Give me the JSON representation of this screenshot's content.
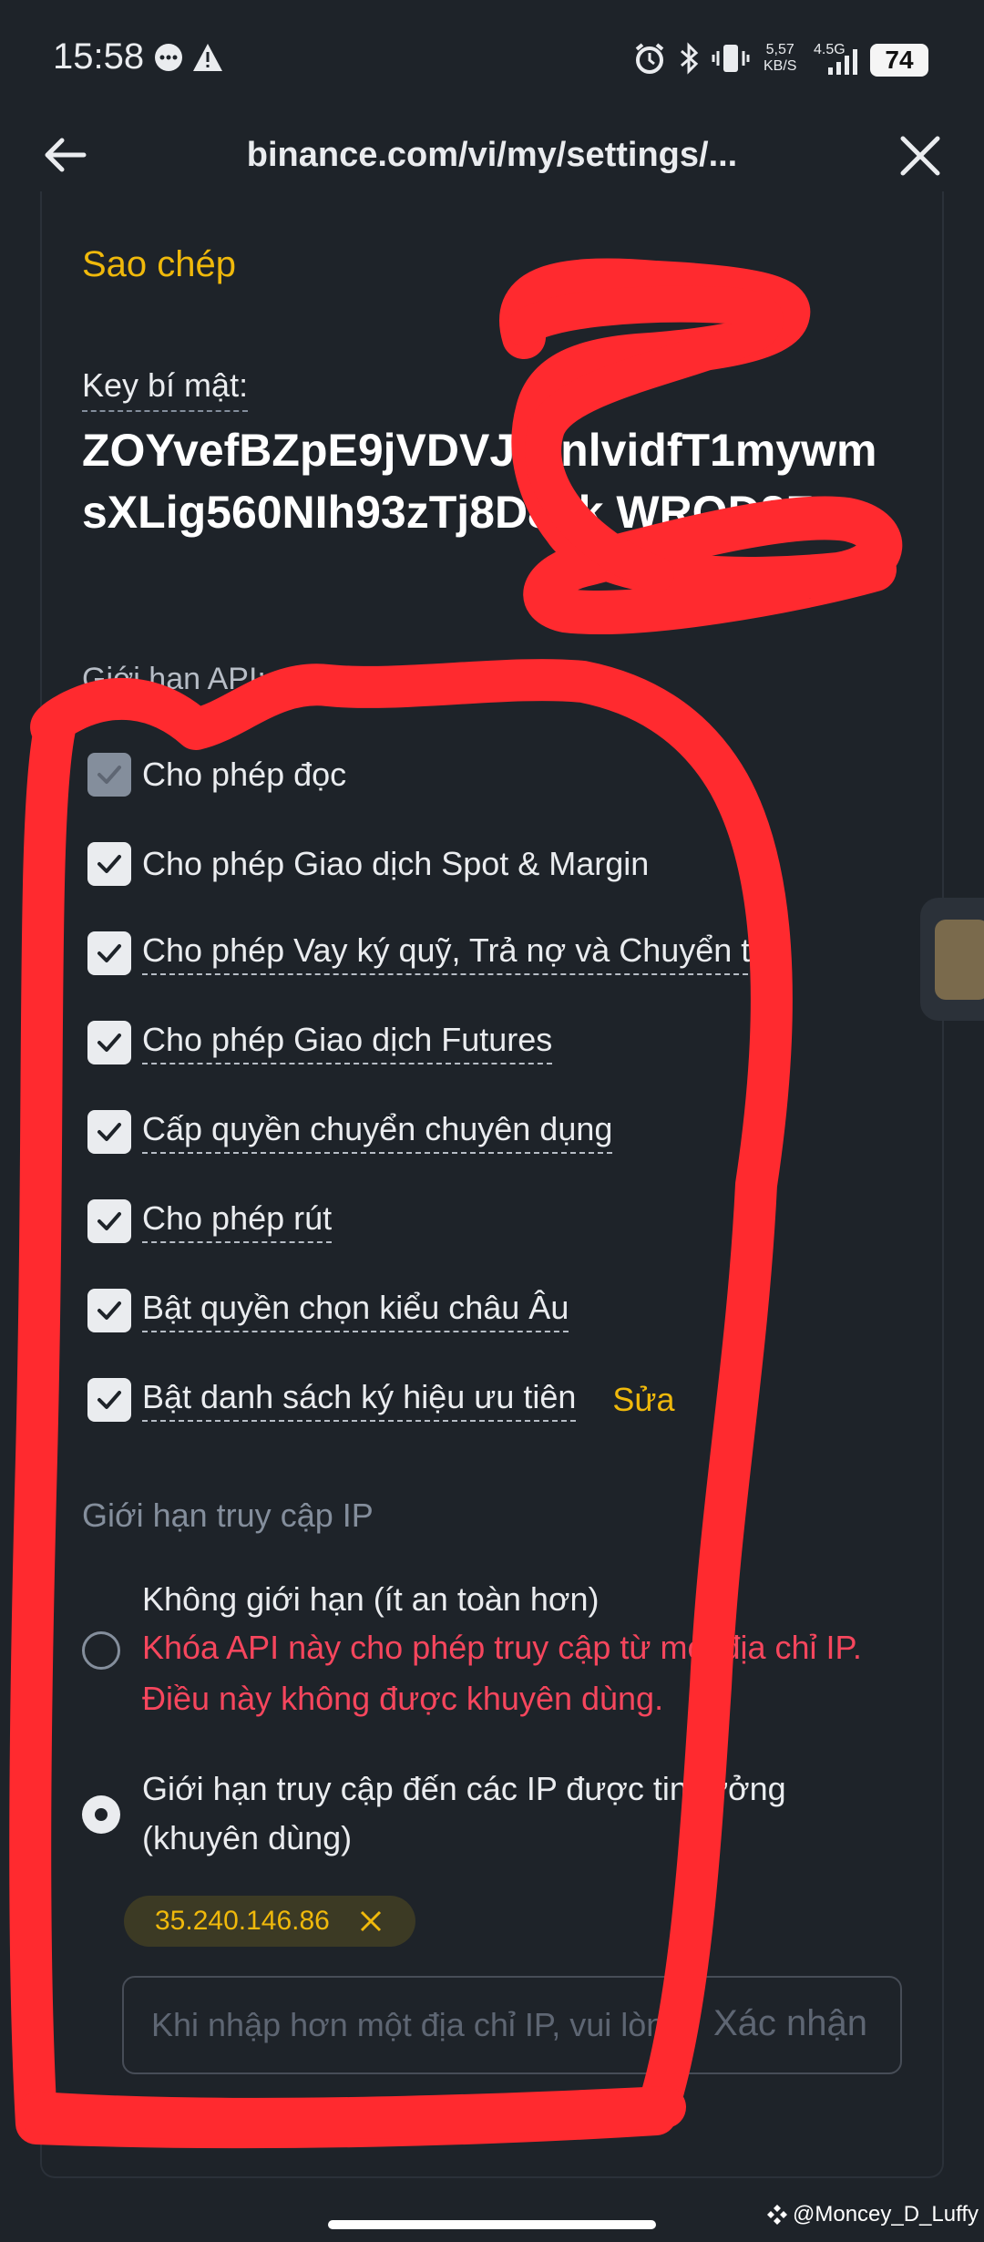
{
  "status_bar": {
    "time": "15:58",
    "net_speed": "5,57",
    "net_unit": "KB/S",
    "network": "4.5G",
    "battery": "74"
  },
  "nav": {
    "url": "binance.com/vi/my/settings/..."
  },
  "copy_label": "Sao chép",
  "secret_key": {
    "label": "Key bí mật:",
    "value": "ZOYvefBZpE9jVDVJtYnlvidfT1mywmsXLig560NIh93zTj8D8Jk WROD8Z"
  },
  "api_restrictions": {
    "label": "Giới hạn API:",
    "permissions": [
      {
        "label": "Cho phép đọc",
        "dashed": false,
        "disabled": true
      },
      {
        "label": "Cho phép Giao dịch Spot & Margin",
        "dashed": false,
        "disabled": false
      },
      {
        "label": "Cho phép Vay ký quỹ, Trả nợ và Chuyển tiề",
        "dashed": true,
        "disabled": false
      },
      {
        "label": "Cho phép Giao dịch Futures",
        "dashed": true,
        "disabled": false
      },
      {
        "label": "Cấp quyền chuyển chuyên dụng",
        "dashed": true,
        "disabled": false
      },
      {
        "label": "Cho phép rút",
        "dashed": true,
        "disabled": false
      },
      {
        "label": "Bật quyền chọn kiểu châu Âu",
        "dashed": true,
        "disabled": false
      },
      {
        "label": "Bật danh sách ký hiệu ưu tiên",
        "dashed": true,
        "disabled": false
      }
    ],
    "edit_label": "Sửa"
  },
  "ip_access": {
    "title": "Giới hạn truy cập IP",
    "unrestricted": {
      "label": "Không giới hạn (ít an toàn hơn)",
      "warning": "Khóa API này cho phép truy cập từ mọi địa chỉ IP. Điều này không được khuyên dùng."
    },
    "restricted": {
      "label": "Giới hạn truy cập đến các IP được tin tưởng (khuyên dùng)"
    },
    "selected": "restricted",
    "ip_chip": "35.240.146.86",
    "input_placeholder": "Khi nhập hơn một địa chỉ IP, vui lòng",
    "confirm_label": "Xác nhận"
  },
  "watermark": "@Moncey_D_Luffy",
  "colors": {
    "background": "#1e2329",
    "accent": "#f0b90b",
    "warning": "#f6465d",
    "annotation": "#ff2a2f"
  }
}
